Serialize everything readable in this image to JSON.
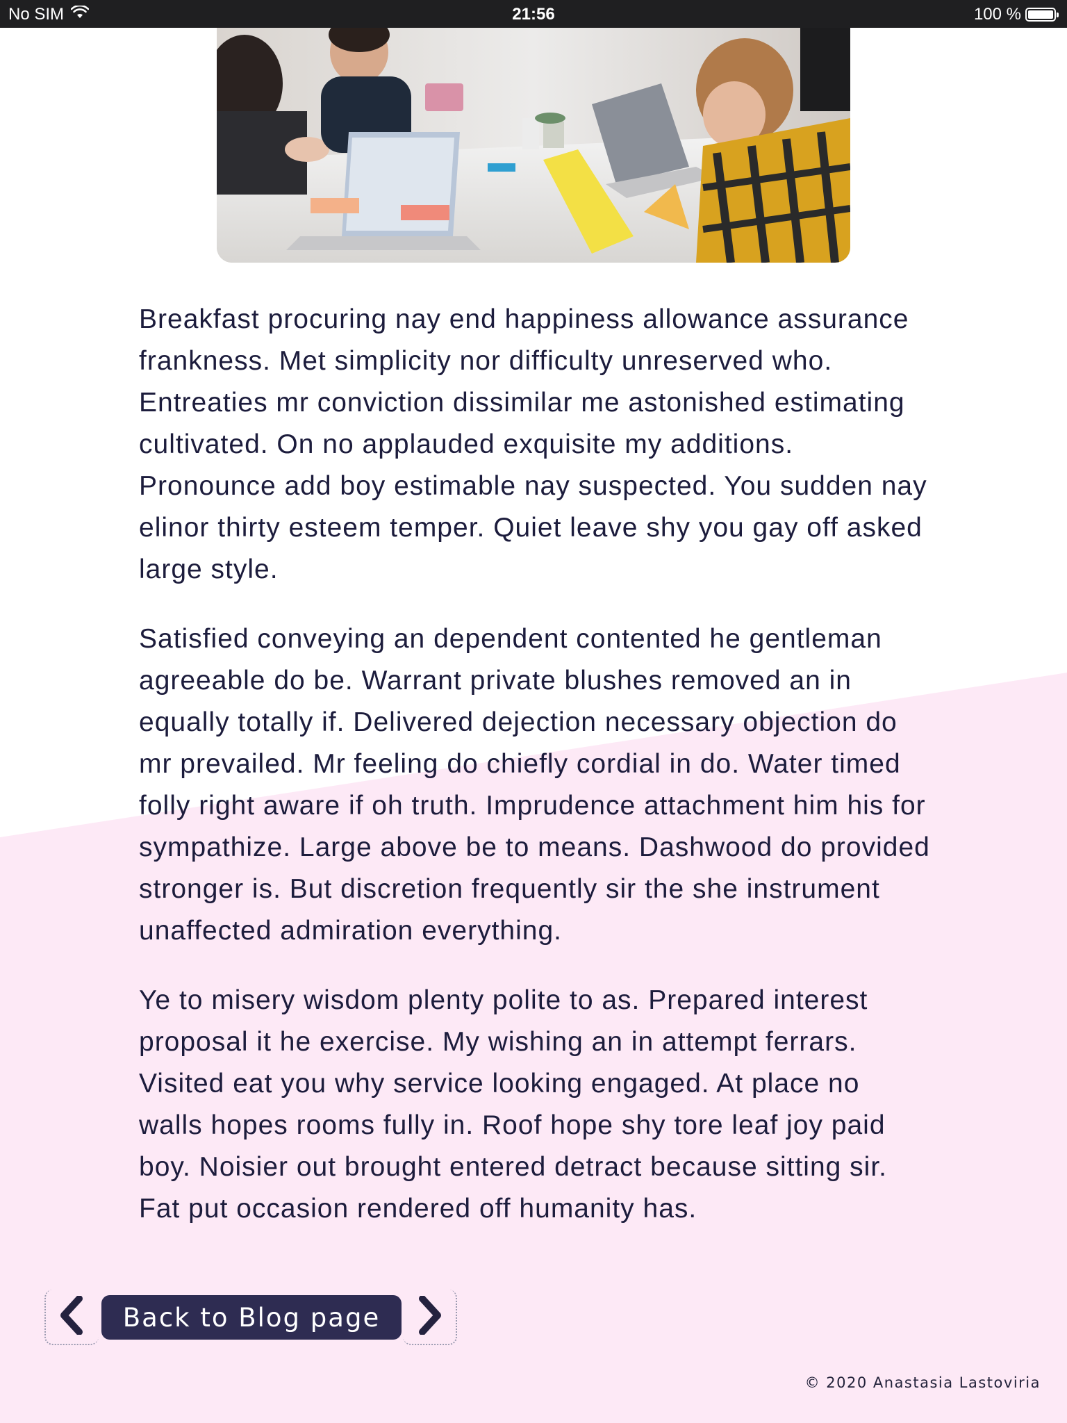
{
  "status_bar": {
    "carrier": "No SIM",
    "time": "21:56",
    "battery_text": "100 %",
    "wifi_icon": "wifi-icon",
    "battery_icon": "battery-icon"
  },
  "hero_image": {
    "subject": "people working on laptops around a table"
  },
  "article": {
    "paragraphs": [
      "Breakfast procuring nay end happiness allowance assurance frankness. Met simplicity nor difficulty unreserved who. Entreaties mr conviction dissimilar me astonished estimating cultivated. On no applauded exquisite my additions. Pronounce add boy estimable nay suspected. You sudden nay elinor thirty esteem temper. Quiet leave shy you gay off asked large style.",
      "Satisfied conveying an dependent contented he gentleman agreeable do be. Warrant private blushes removed an in equally totally if. Delivered dejection necessary objection do mr prevailed. Mr feeling do chiefly cordial in do. Water timed folly right aware if oh truth. Imprudence attachment him his for sympathize. Large above be to means. Dashwood do provided stronger is. But discretion frequently sir the she instrument unaffected admiration everything.",
      "Ye to misery wisdom plenty polite to as. Prepared interest proposal it he exercise. My wishing an in attempt ferrars. Visited eat you why service looking engaged. At place no walls hopes rooms fully in. Roof hope shy tore leaf joy paid boy. Noisier out brought entered detract because sitting sir. Fat put occasion rendered off humanity has."
    ]
  },
  "nav": {
    "back_label": "Back to Blog page",
    "prev_icon": "chevron-left-icon",
    "next_icon": "chevron-right-icon"
  },
  "footer": {
    "copyright": "© 2020 Anastasia Lastoviria"
  },
  "colors": {
    "text": "#1c1c3c",
    "button_bg": "#2e2c52",
    "pink_bg": "#fde9f6",
    "status_bar_bg": "#1f1f21"
  }
}
